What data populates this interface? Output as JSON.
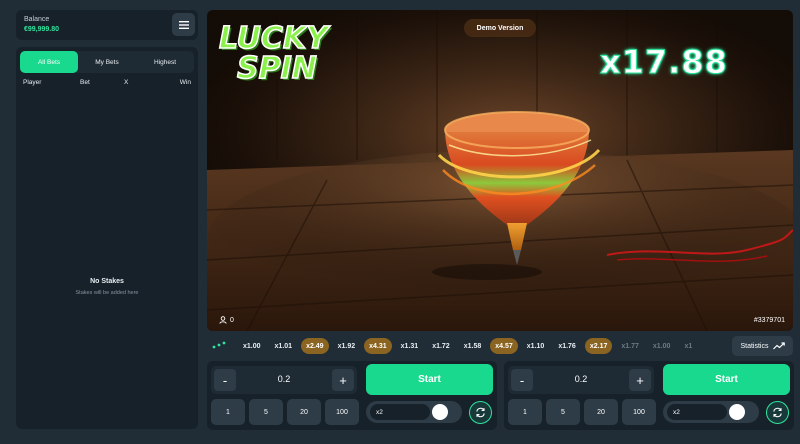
{
  "balance": {
    "label": "Balance",
    "value": "€99,999.80"
  },
  "bets": {
    "tabs": [
      "All Bets",
      "My Bets",
      "Highest"
    ],
    "active_tab": 0,
    "columns": {
      "player": "Player",
      "bet": "Bet",
      "x": "X",
      "win": "Win"
    },
    "empty_title": "No Stakes",
    "empty_subtitle": "Stakes will be added here"
  },
  "game": {
    "logo_line1": "LUCKY",
    "logo_line2": "SPIN",
    "badge": "Demo Version",
    "multiplier": "x17.88",
    "players_count": "0",
    "round_id": "#3379701"
  },
  "history": {
    "items": [
      {
        "label": "x1.00",
        "style": "normal"
      },
      {
        "label": "x1.01",
        "style": "normal"
      },
      {
        "label": "x2.49",
        "style": "high"
      },
      {
        "label": "x1.92",
        "style": "normal"
      },
      {
        "label": "x4.31",
        "style": "high"
      },
      {
        "label": "x1.31",
        "style": "normal"
      },
      {
        "label": "x1.72",
        "style": "normal"
      },
      {
        "label": "x1.58",
        "style": "normal"
      },
      {
        "label": "x4.57",
        "style": "high"
      },
      {
        "label": "x1.10",
        "style": "normal"
      },
      {
        "label": "x1.76",
        "style": "normal"
      },
      {
        "label": "x2.17",
        "style": "high"
      },
      {
        "label": "x1.77",
        "style": "dim"
      },
      {
        "label": "x1.00",
        "style": "dim"
      },
      {
        "label": "x1",
        "style": "dim"
      }
    ],
    "statistics_label": "Statistics"
  },
  "bet_panels": [
    {
      "minus": "-",
      "plus": "+",
      "amount": "0.2",
      "start": "Start",
      "chips": [
        "1",
        "5",
        "20",
        "100"
      ],
      "auto_value": "x2"
    },
    {
      "minus": "-",
      "plus": "+",
      "amount": "0.2",
      "start": "Start",
      "chips": [
        "1",
        "5",
        "20",
        "100"
      ],
      "auto_value": "x2"
    }
  ],
  "icons": {
    "menu": "hamburger-icon",
    "players": "user-icon",
    "history": "dots-icon",
    "statistics": "trend-icon",
    "auto": "repeat-icon"
  },
  "colors": {
    "accent": "#19d98e",
    "balance": "#2ee59d",
    "high_multiplier": "#8a6420",
    "panel": "#17212a",
    "background": "#202c36"
  }
}
